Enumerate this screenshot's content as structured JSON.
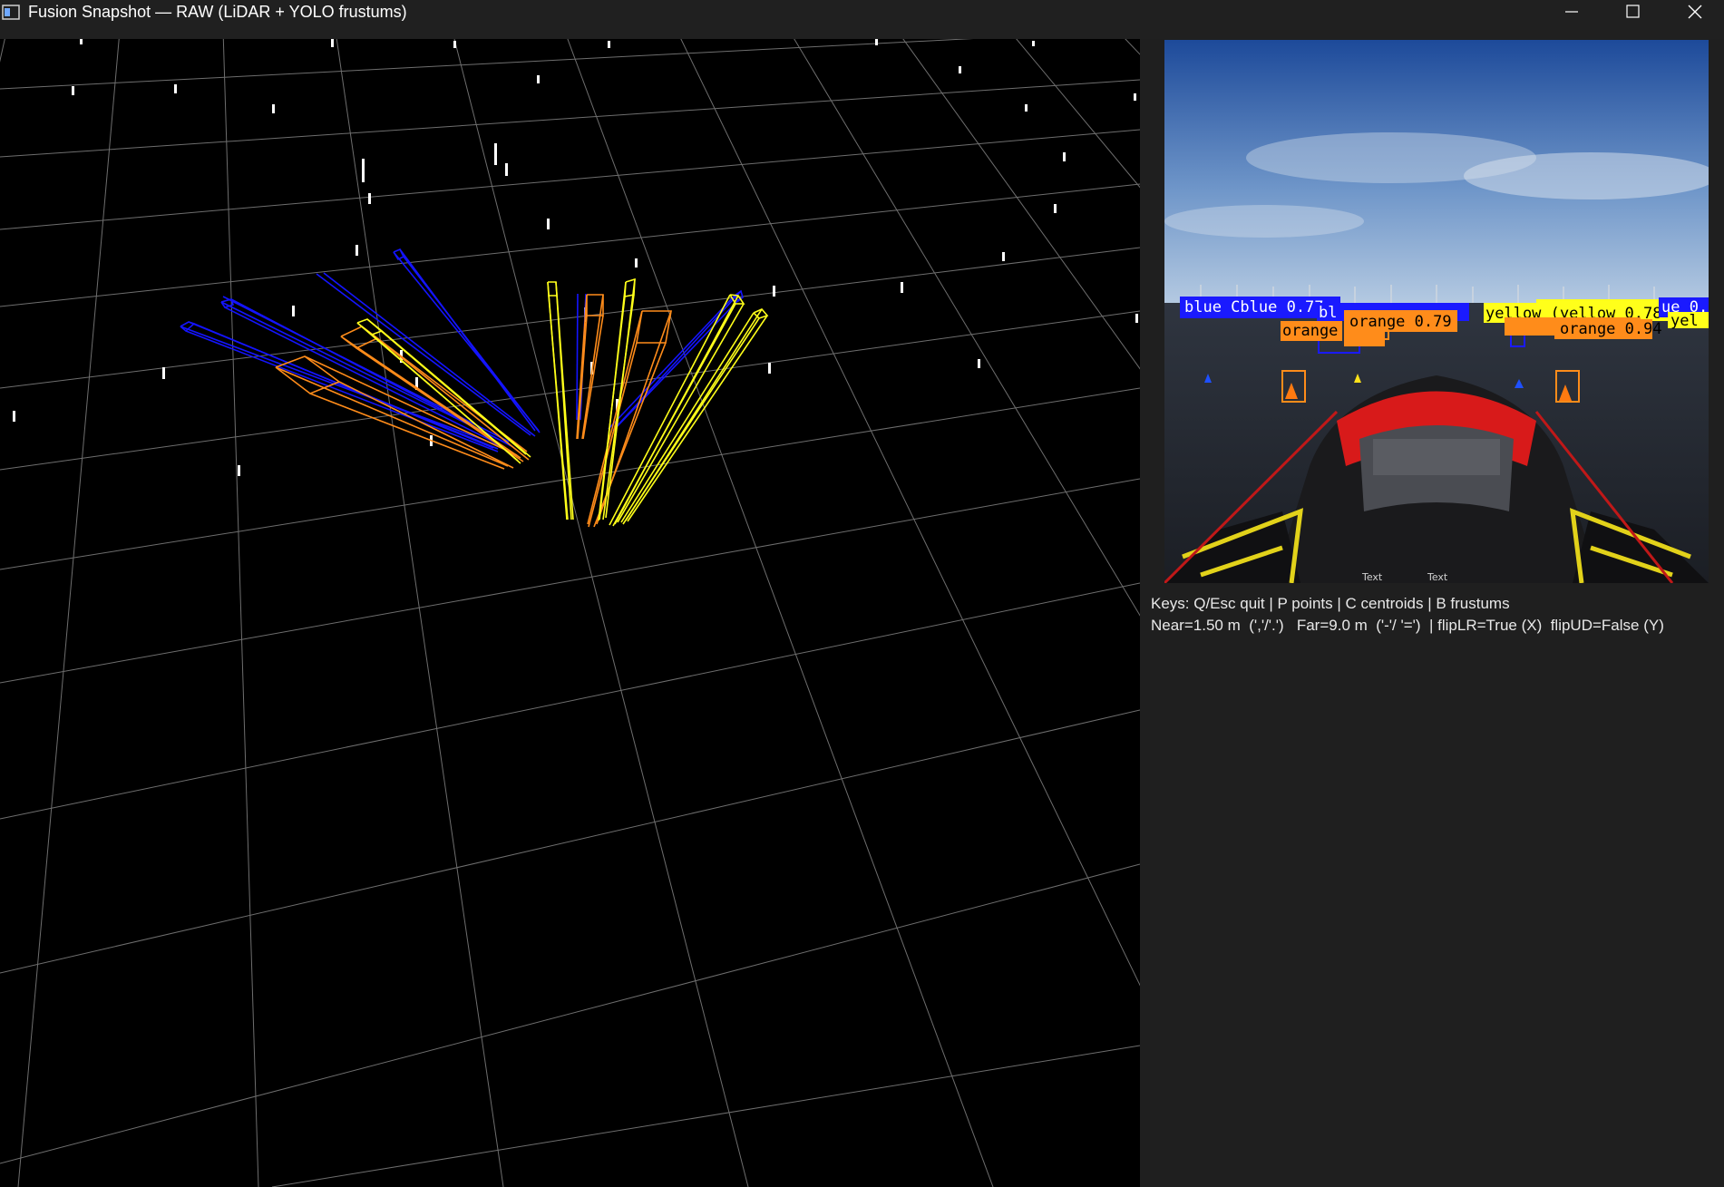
{
  "window": {
    "title": "Fusion Snapshot — RAW (LiDAR + YOLO frustums)",
    "buttons": [
      "minimize",
      "maximize",
      "close"
    ]
  },
  "camera": {
    "detections": [
      {
        "label": "blue",
        "score": "0.77",
        "text": "blue  Cblue  0.77",
        "color": "#1a1aff"
      },
      {
        "label": "blue",
        "score": "",
        "text": "bl",
        "color": "#1a1aff"
      },
      {
        "label": "blue",
        "score": "",
        "text": "",
        "color": "#1a1aff"
      },
      {
        "label": "orange",
        "score": "0.79",
        "text": "orange  0.79",
        "color": "#ff8c1a"
      },
      {
        "label": "orange",
        "score": "",
        "text": "orange",
        "color": "#ff8c1a"
      },
      {
        "label": "yellow",
        "score": "0.78",
        "text": "yellow  (yellow  0.78",
        "color": "#ffff1a"
      },
      {
        "label": "orange",
        "score": "0.94",
        "text": "orange  0.94",
        "color": "#ff8c1a"
      },
      {
        "label": "blue",
        "score": "",
        "text": "ue 0.",
        "color": "#1a1aff"
      },
      {
        "label": "yellow",
        "score": "",
        "text": "yel",
        "color": "#ffff1a"
      }
    ],
    "overlay_text": [
      "Text",
      "Text"
    ]
  },
  "info": {
    "keys_line": "Keys: Q/Esc quit | P points | C centroids | B frustums",
    "params_line": "Near=1.50 m  (','/'.')   Far=9.0 m  ('-'/ '=')  | flipLR=True (X)  flipUD=False (Y)"
  },
  "colors": {
    "blue": "#1414ff",
    "orange": "#ff8c1a",
    "yellow": "#ffff1a",
    "grid": "#6e6e6e",
    "points": "#ffffff"
  }
}
